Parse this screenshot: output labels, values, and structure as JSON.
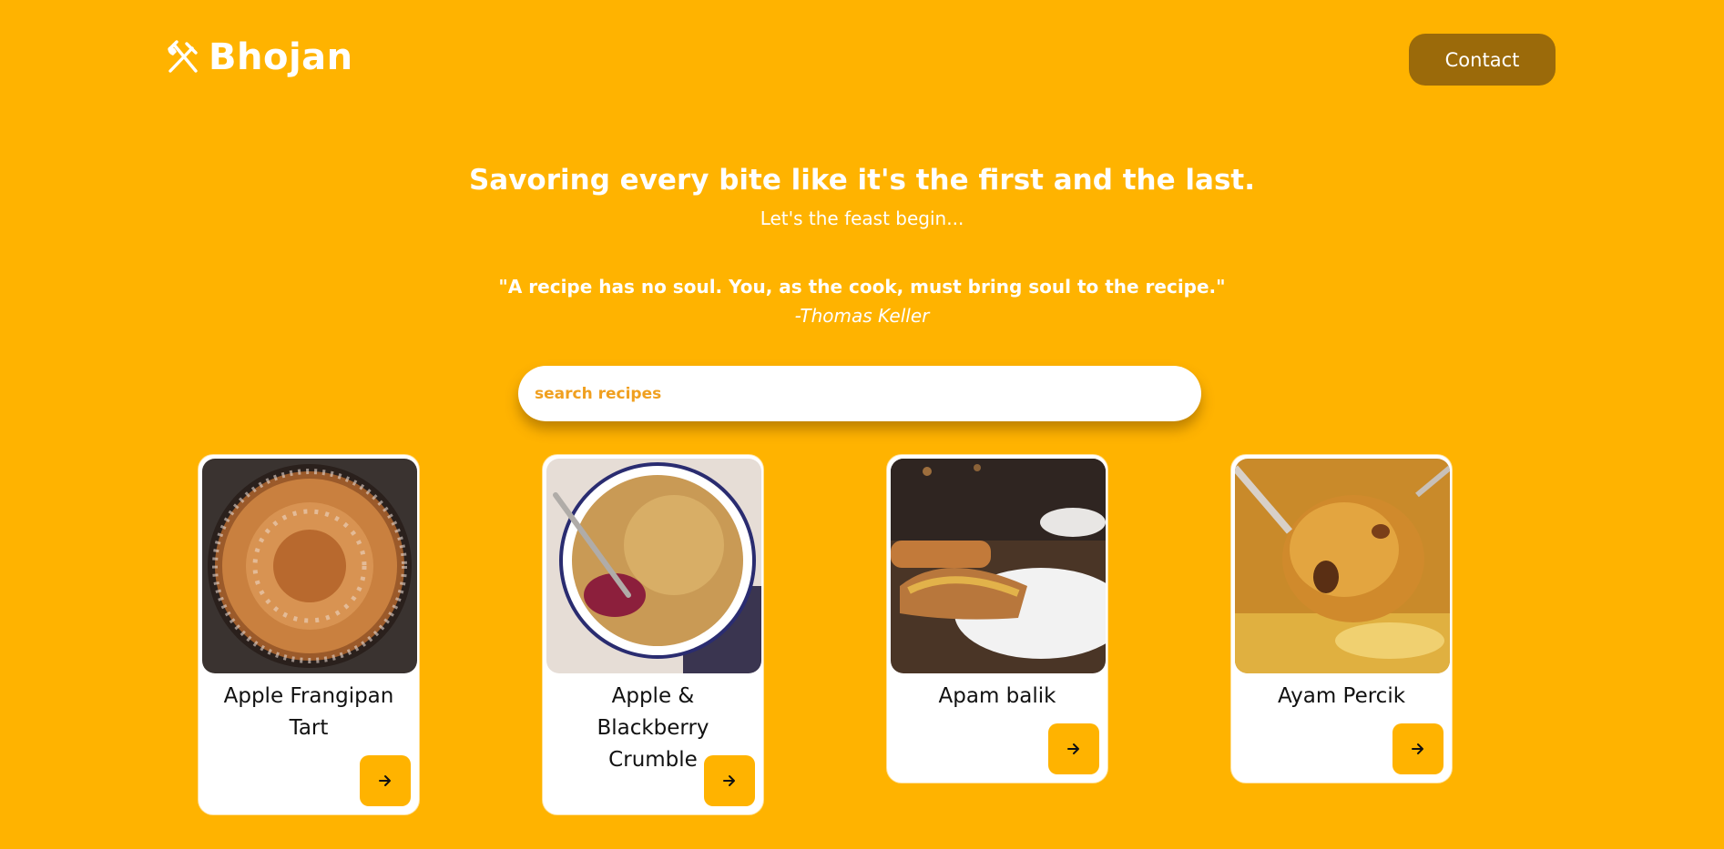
{
  "header": {
    "brand": "Bhojan",
    "brand_icon": "utensils-icon",
    "contact_label": "Contact"
  },
  "hero": {
    "title": "Savoring every bite like it's the first and the last.",
    "subtitle": "Let's the feast begin..."
  },
  "quote": {
    "text": "\"A recipe has no soul. You, as the cook, must bring soul to the recipe.\"",
    "author": "-Thomas Keller"
  },
  "search": {
    "placeholder": "search recipes",
    "value": ""
  },
  "recipes": [
    {
      "title": "Apple Frangipan Tart",
      "button_icon": "arrow-right-icon"
    },
    {
      "title": "Apple & Blackberry Crumble",
      "button_icon": "arrow-right-icon"
    },
    {
      "title": "Apam balik",
      "button_icon": "arrow-right-icon"
    },
    {
      "title": "Ayam Percik",
      "button_icon": "arrow-right-icon"
    }
  ],
  "colors": {
    "background": "#FFB300",
    "contact_button": "#9B6A0A",
    "card": "#FFFFFF",
    "card_button": "#FFB300"
  }
}
